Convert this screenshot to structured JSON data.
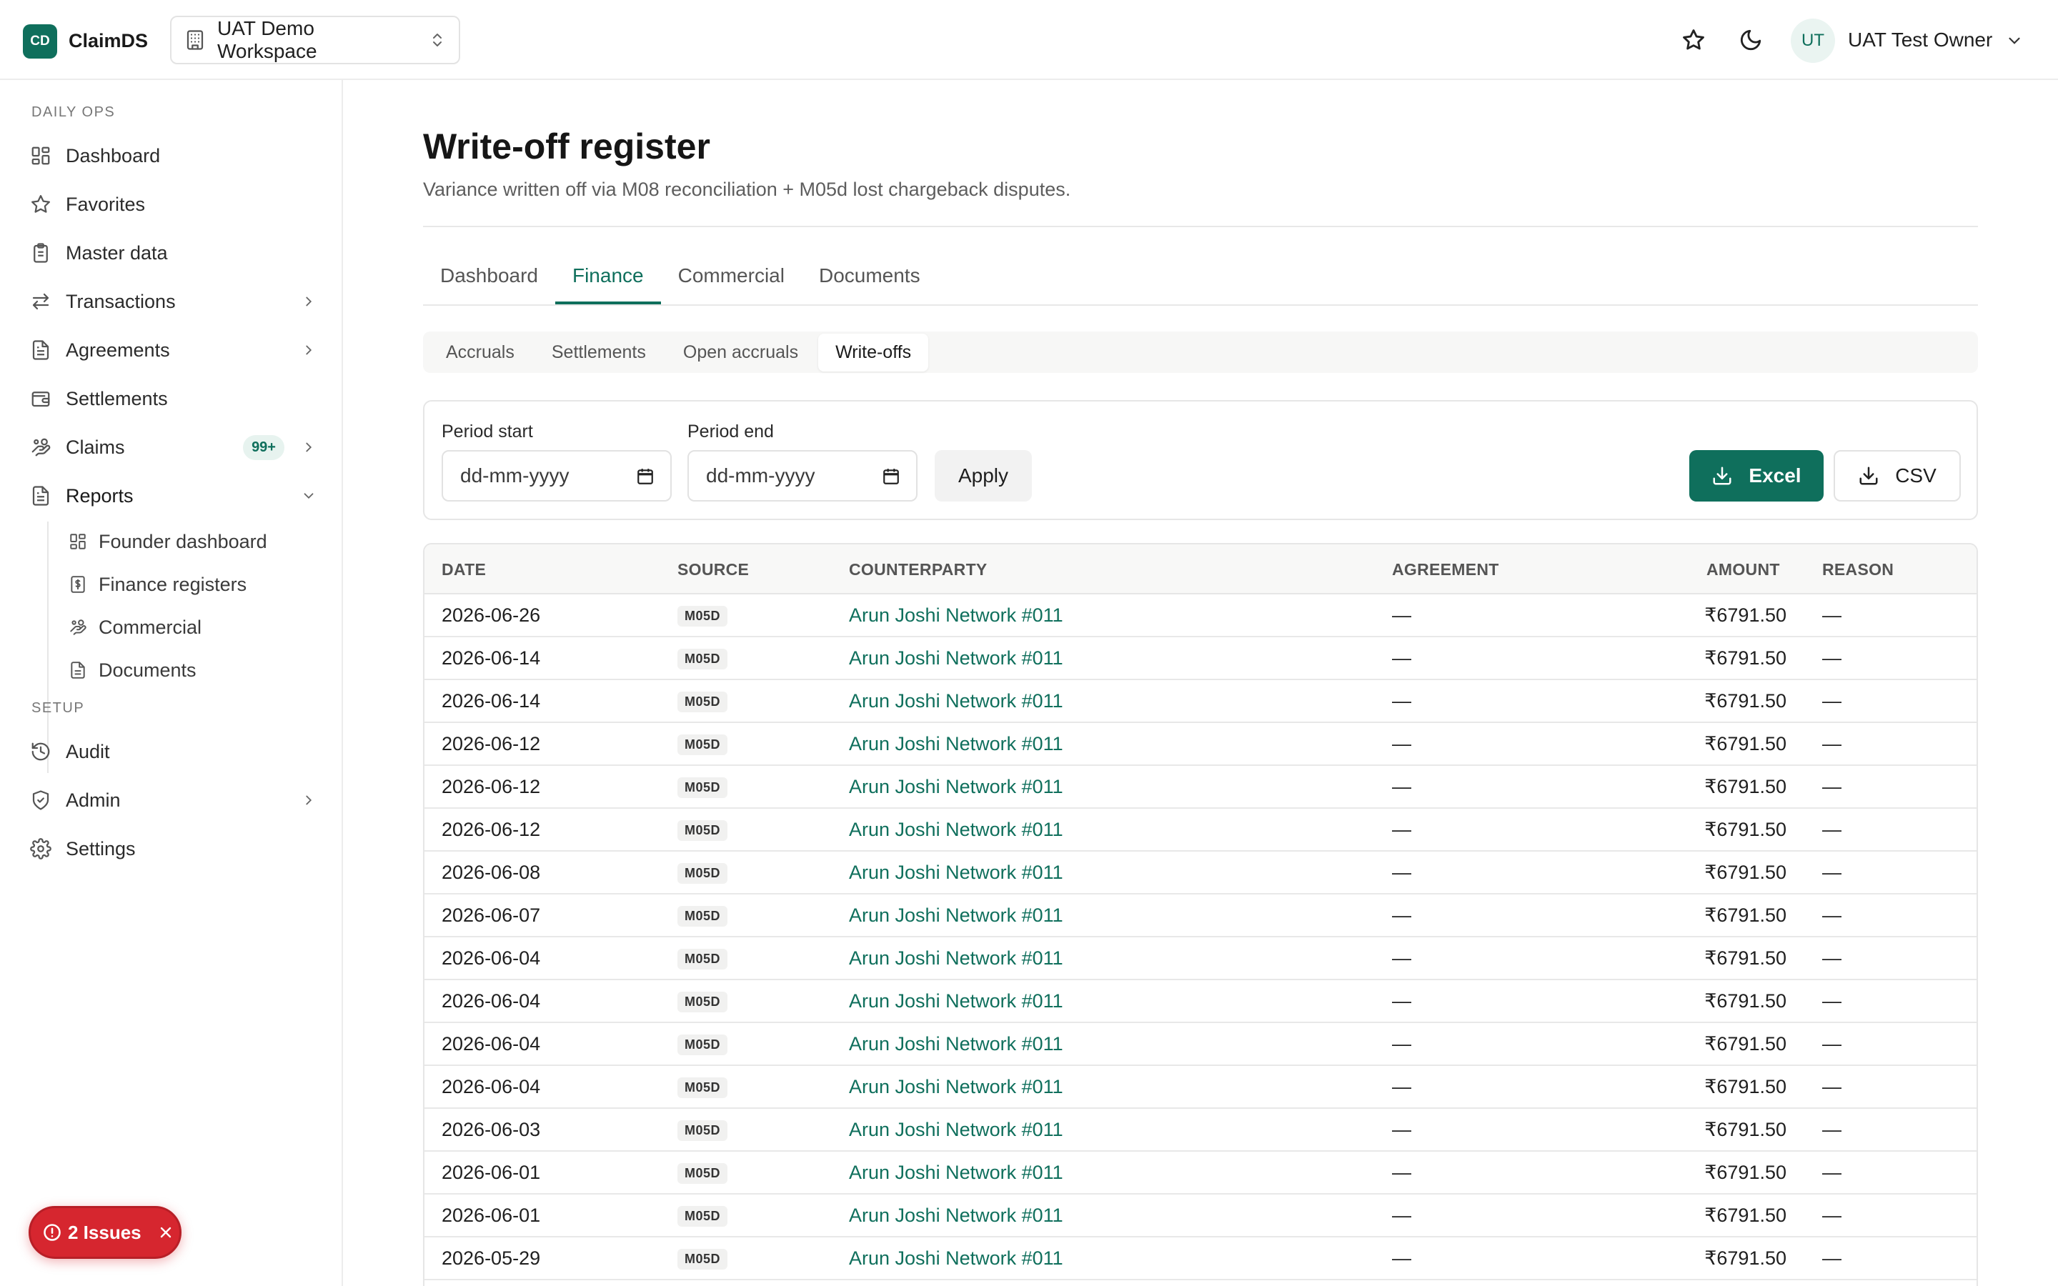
{
  "header": {
    "logo_text": "CD",
    "app_name": "ClaimDS",
    "workspace": "UAT Demo Workspace",
    "user_initials": "UT",
    "user_name": "UAT Test Owner"
  },
  "sidebar": {
    "section_daily": "DAILY OPS",
    "section_setup": "SETUP",
    "items": [
      {
        "label": "Dashboard",
        "icon": "dashboard-grid-icon"
      },
      {
        "label": "Favorites",
        "icon": "star-icon"
      },
      {
        "label": "Master data",
        "icon": "clipboard-icon"
      },
      {
        "label": "Transactions",
        "icon": "arrows-swap-icon"
      },
      {
        "label": "Agreements",
        "icon": "file-text-icon"
      },
      {
        "label": "Settlements",
        "icon": "wallet-icon"
      },
      {
        "label": "Claims",
        "icon": "hand-coins-icon",
        "badge": "99+"
      },
      {
        "label": "Reports",
        "icon": "report-file-icon"
      }
    ],
    "report_children": [
      {
        "label": "Founder dashboard",
        "icon": "dashboard-grid-icon"
      },
      {
        "label": "Finance registers",
        "icon": "dollar-file-icon"
      },
      {
        "label": "Commercial",
        "icon": "hand-coins-icon"
      },
      {
        "label": "Documents",
        "icon": "file-text-icon"
      }
    ],
    "setup_items": [
      {
        "label": "Audit",
        "icon": "history-icon"
      },
      {
        "label": "Admin",
        "icon": "shield-check-icon"
      },
      {
        "label": "Settings",
        "icon": "gear-icon"
      }
    ]
  },
  "issues": {
    "label": "2 Issues"
  },
  "page": {
    "title": "Write-off register",
    "subtitle": "Variance written off via M08 reconciliation + M05d lost chargeback disputes."
  },
  "tabs": [
    "Dashboard",
    "Finance",
    "Commercial",
    "Documents"
  ],
  "active_tab": "Finance",
  "subtabs": [
    "Accruals",
    "Settlements",
    "Open accruals",
    "Write-offs"
  ],
  "active_subtab": "Write-offs",
  "filters": {
    "period_start_label": "Period start",
    "period_end_label": "Period end",
    "date_placeholder": "dd-mm-yyyy",
    "apply_label": "Apply",
    "excel_label": "Excel",
    "csv_label": "CSV"
  },
  "table": {
    "columns": [
      "DATE",
      "SOURCE",
      "COUNTERPARTY",
      "AGREEMENT",
      "AMOUNT",
      "REASON"
    ],
    "rows": [
      {
        "date": "2026-06-26",
        "source": "M05D",
        "counterparty": "Arun Joshi Network #011",
        "agreement": "—",
        "amount": "₹6791.50",
        "reason": "—"
      },
      {
        "date": "2026-06-14",
        "source": "M05D",
        "counterparty": "Arun Joshi Network #011",
        "agreement": "—",
        "amount": "₹6791.50",
        "reason": "—"
      },
      {
        "date": "2026-06-14",
        "source": "M05D",
        "counterparty": "Arun Joshi Network #011",
        "agreement": "—",
        "amount": "₹6791.50",
        "reason": "—"
      },
      {
        "date": "2026-06-12",
        "source": "M05D",
        "counterparty": "Arun Joshi Network #011",
        "agreement": "—",
        "amount": "₹6791.50",
        "reason": "—"
      },
      {
        "date": "2026-06-12",
        "source": "M05D",
        "counterparty": "Arun Joshi Network #011",
        "agreement": "—",
        "amount": "₹6791.50",
        "reason": "—"
      },
      {
        "date": "2026-06-12",
        "source": "M05D",
        "counterparty": "Arun Joshi Network #011",
        "agreement": "—",
        "amount": "₹6791.50",
        "reason": "—"
      },
      {
        "date": "2026-06-08",
        "source": "M05D",
        "counterparty": "Arun Joshi Network #011",
        "agreement": "—",
        "amount": "₹6791.50",
        "reason": "—"
      },
      {
        "date": "2026-06-07",
        "source": "M05D",
        "counterparty": "Arun Joshi Network #011",
        "agreement": "—",
        "amount": "₹6791.50",
        "reason": "—"
      },
      {
        "date": "2026-06-04",
        "source": "M05D",
        "counterparty": "Arun Joshi Network #011",
        "agreement": "—",
        "amount": "₹6791.50",
        "reason": "—"
      },
      {
        "date": "2026-06-04",
        "source": "M05D",
        "counterparty": "Arun Joshi Network #011",
        "agreement": "—",
        "amount": "₹6791.50",
        "reason": "—"
      },
      {
        "date": "2026-06-04",
        "source": "M05D",
        "counterparty": "Arun Joshi Network #011",
        "agreement": "—",
        "amount": "₹6791.50",
        "reason": "—"
      },
      {
        "date": "2026-06-04",
        "source": "M05D",
        "counterparty": "Arun Joshi Network #011",
        "agreement": "—",
        "amount": "₹6791.50",
        "reason": "—"
      },
      {
        "date": "2026-06-03",
        "source": "M05D",
        "counterparty": "Arun Joshi Network #011",
        "agreement": "—",
        "amount": "₹6791.50",
        "reason": "—"
      },
      {
        "date": "2026-06-01",
        "source": "M05D",
        "counterparty": "Arun Joshi Network #011",
        "agreement": "—",
        "amount": "₹6791.50",
        "reason": "—"
      },
      {
        "date": "2026-06-01",
        "source": "M05D",
        "counterparty": "Arun Joshi Network #011",
        "agreement": "—",
        "amount": "₹6791.50",
        "reason": "—"
      },
      {
        "date": "2026-05-29",
        "source": "M05D",
        "counterparty": "Arun Joshi Network #011",
        "agreement": "—",
        "amount": "₹6791.50",
        "reason": "—"
      }
    ]
  },
  "colors": {
    "brand": "#0f6f5c",
    "danger": "#d6262f"
  }
}
